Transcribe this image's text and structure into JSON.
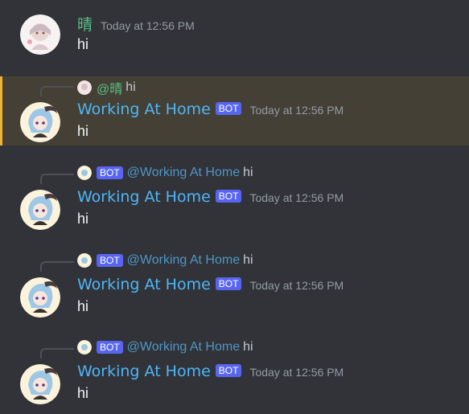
{
  "messages": [
    {
      "username": "晴",
      "timestamp": "Today at 12:56 PM",
      "text": "hi"
    },
    {
      "reply": {
        "mention": "@晴",
        "text": "hi"
      },
      "username": "Working At Home",
      "bot_tag": "BOT",
      "timestamp": "Today at 12:56 PM",
      "text": "hi"
    },
    {
      "reply": {
        "bot_tag": "BOT",
        "mention": "@Working At Home",
        "text": "hi"
      },
      "username": "Working At Home",
      "bot_tag": "BOT",
      "timestamp": "Today at 12:56 PM",
      "text": "hi"
    },
    {
      "reply": {
        "bot_tag": "BOT",
        "mention": "@Working At Home",
        "text": "hi"
      },
      "username": "Working At Home",
      "bot_tag": "BOT",
      "timestamp": "Today at 12:56 PM",
      "text": "hi"
    },
    {
      "reply": {
        "bot_tag": "BOT",
        "mention": "@Working At Home",
        "text": "hi"
      },
      "username": "Working At Home",
      "bot_tag": "BOT",
      "timestamp": "Today at 12:56 PM",
      "text": "hi"
    }
  ],
  "colors": {
    "background": "#313338",
    "highlight_bg": "#444036",
    "highlight_bar": "#f0b232",
    "user_green": "#57c084",
    "bot_blue": "#4fb6f7",
    "bot_tag": "#5865f2"
  },
  "icons": {
    "user_avatar": "girl-avatar-icon",
    "bot_avatar": "anime-character-avatar-icon"
  }
}
